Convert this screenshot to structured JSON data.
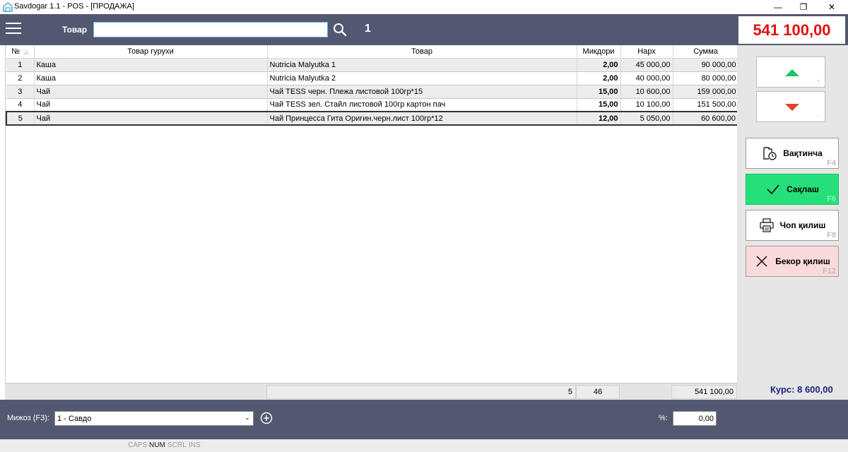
{
  "window": {
    "title": "Savdogar 1.1 - POS - [ПРОДАЖА]",
    "minimize": "—",
    "maximize": "❐",
    "close": "✕"
  },
  "toolbar": {
    "search_label": "Товар",
    "search_value": "",
    "quantity": "1"
  },
  "total": "541 100,00",
  "table": {
    "columns": [
      "№",
      "Товар гурухи",
      "Товар",
      "Микдори",
      "Нарх",
      "Сумма"
    ],
    "rows": [
      {
        "num": "1",
        "group": "Каша",
        "product": "Nutricia Malyutka 1",
        "qty": "2,00",
        "price": "45 000,00",
        "sum": "90 000,00"
      },
      {
        "num": "2",
        "group": "Каша",
        "product": "Nutricia Malyutka 2",
        "qty": "2,00",
        "price": "40 000,00",
        "sum": "80 000,00"
      },
      {
        "num": "3",
        "group": "Чай",
        "product": "Чай TESS черн. Плежа листовой 100гр*15",
        "qty": "15,00",
        "price": "10 600,00",
        "sum": "159 000,00"
      },
      {
        "num": "4",
        "group": "Чай",
        "product": "Чай TESS зел. Стайл листовой 100гр картон пач",
        "qty": "15,00",
        "price": "10 100,00",
        "sum": "151 500,00"
      },
      {
        "num": "5",
        "group": "Чай",
        "product": "Чай Принцесса Гита Оригин.черн.лист 100гр*12",
        "qty": "12,00",
        "price": "5 050,00",
        "sum": "60 600,00"
      }
    ],
    "footer": {
      "count": "5",
      "qty_total": "46",
      "sum_total": "541 100,00"
    }
  },
  "right_panel": {
    "up_key": "+",
    "down_key": "-",
    "pause": {
      "label": "Вақтинча",
      "key": "F4"
    },
    "save": {
      "label": "Сақлаш",
      "key": "F6"
    },
    "print": {
      "label": "Чоп қилиш",
      "key": "F9"
    },
    "cancel": {
      "label": "Бекор қилиш",
      "key": "F12"
    },
    "rate": "Курс: 8 600,00"
  },
  "bottom": {
    "client_label": "Мижоз (F3):",
    "client_value": "1 - Савдо",
    "percent_label": "%:",
    "percent_value": "0,00"
  },
  "status": {
    "caps": "CAPS",
    "num": "NUM",
    "scrl": "SCRL",
    "ins": "INS"
  },
  "colors": {
    "toolbar_bg": "#525870",
    "total_text": "#e01010",
    "save_bg": "#25e07a",
    "cancel_bg": "#fadada",
    "rate_text": "#1a237e"
  }
}
